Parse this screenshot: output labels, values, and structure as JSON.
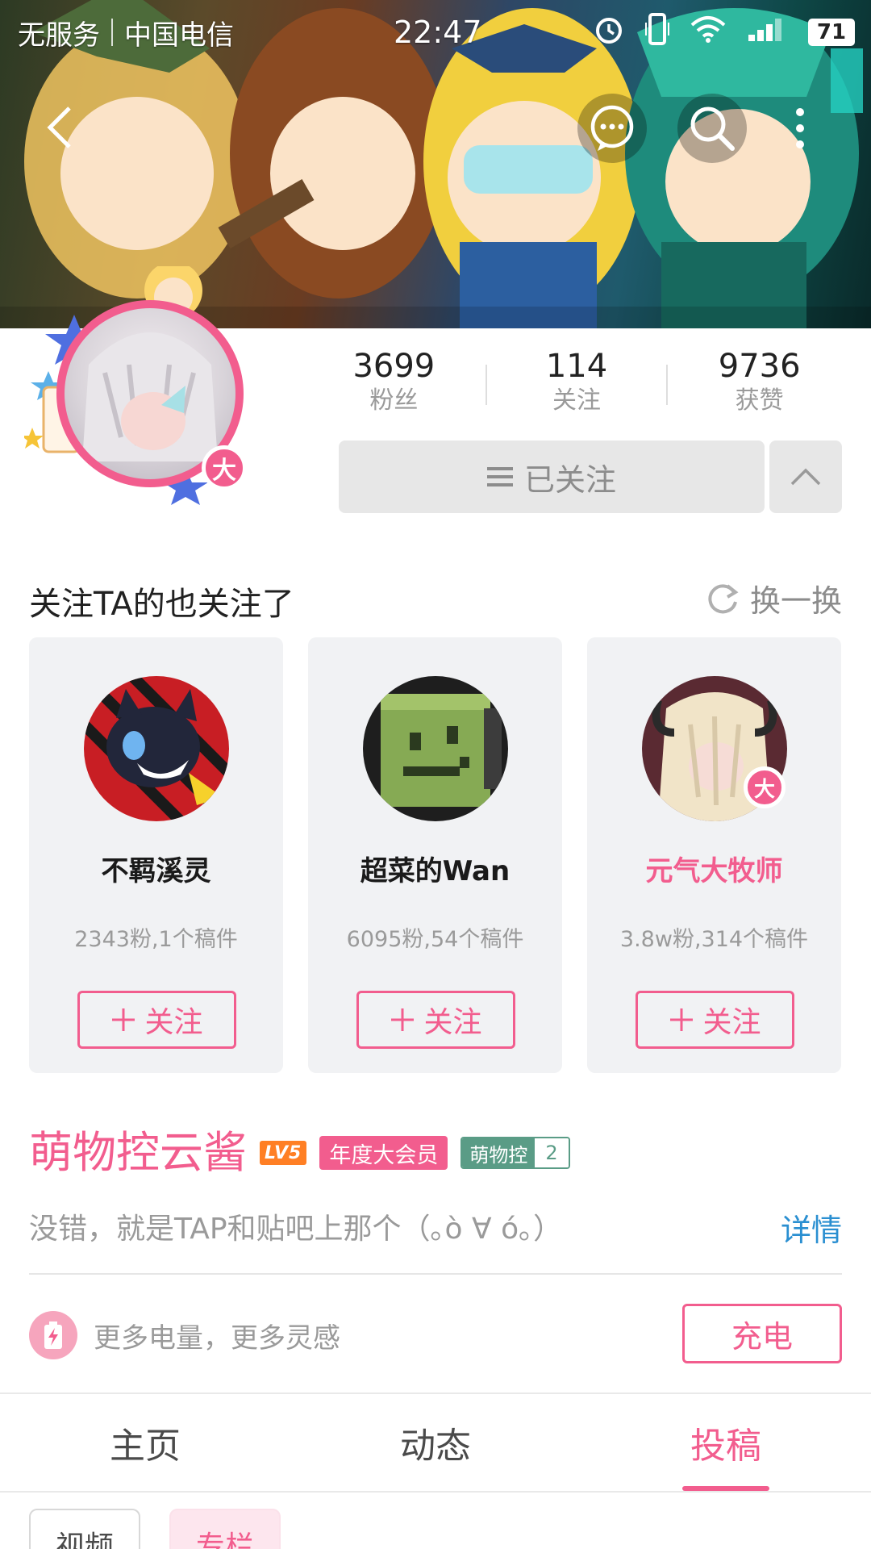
{
  "status_bar": {
    "carrier1": "无服务",
    "carrier2": "中国电信",
    "time": "22:47",
    "battery": "71",
    "icons": [
      "alarm-icon",
      "vibrate-icon",
      "wifi-icon",
      "signal-icon",
      "battery-icon"
    ]
  },
  "nav": {
    "icons": [
      "back-arrow-icon",
      "chat-bubble-icon",
      "search-icon",
      "more-vertical-icon"
    ]
  },
  "profile": {
    "big_member_badge": "大",
    "stats": [
      {
        "value": "3699",
        "label": "粉丝"
      },
      {
        "value": "114",
        "label": "关注"
      },
      {
        "value": "9736",
        "label": "获赞"
      }
    ],
    "followed_button": "已关注",
    "username": "萌物控云酱",
    "level": "LV5",
    "vip_tag": "年度大会员",
    "medal": {
      "name": "萌物控",
      "level": "2"
    },
    "signature": "没错，就是TAP和贴吧上那个（｡ò ∀ ó｡）",
    "detail_link": "详情",
    "charge": {
      "text": "更多电量，更多灵感",
      "button": "充电"
    }
  },
  "recommend": {
    "title": "关注TA的也关注了",
    "refresh": "换一换",
    "cards": [
      {
        "name": "不羁溪灵",
        "sub": "2343粉,1个稿件",
        "button": "关注",
        "vip": false
      },
      {
        "name": "超菜的Wan",
        "sub": "6095粉,54个稿件",
        "button": "关注",
        "vip": false
      },
      {
        "name": "元气大牧师",
        "sub": "3.8w粉,314个稿件",
        "button": "关注",
        "vip": true,
        "badge": "大"
      }
    ]
  },
  "tabs": [
    {
      "label": "主页",
      "active": false
    },
    {
      "label": "动态",
      "active": false
    },
    {
      "label": "投稿",
      "active": true
    }
  ],
  "subtabs": [
    {
      "label": "视频",
      "active": false
    },
    {
      "label": "专栏",
      "active": true
    }
  ],
  "colors": {
    "accent_pink": "#f25d8e",
    "link_blue": "#2a8fd1",
    "level_orange": "#ff7f24",
    "medal_green": "#5a9c86"
  }
}
